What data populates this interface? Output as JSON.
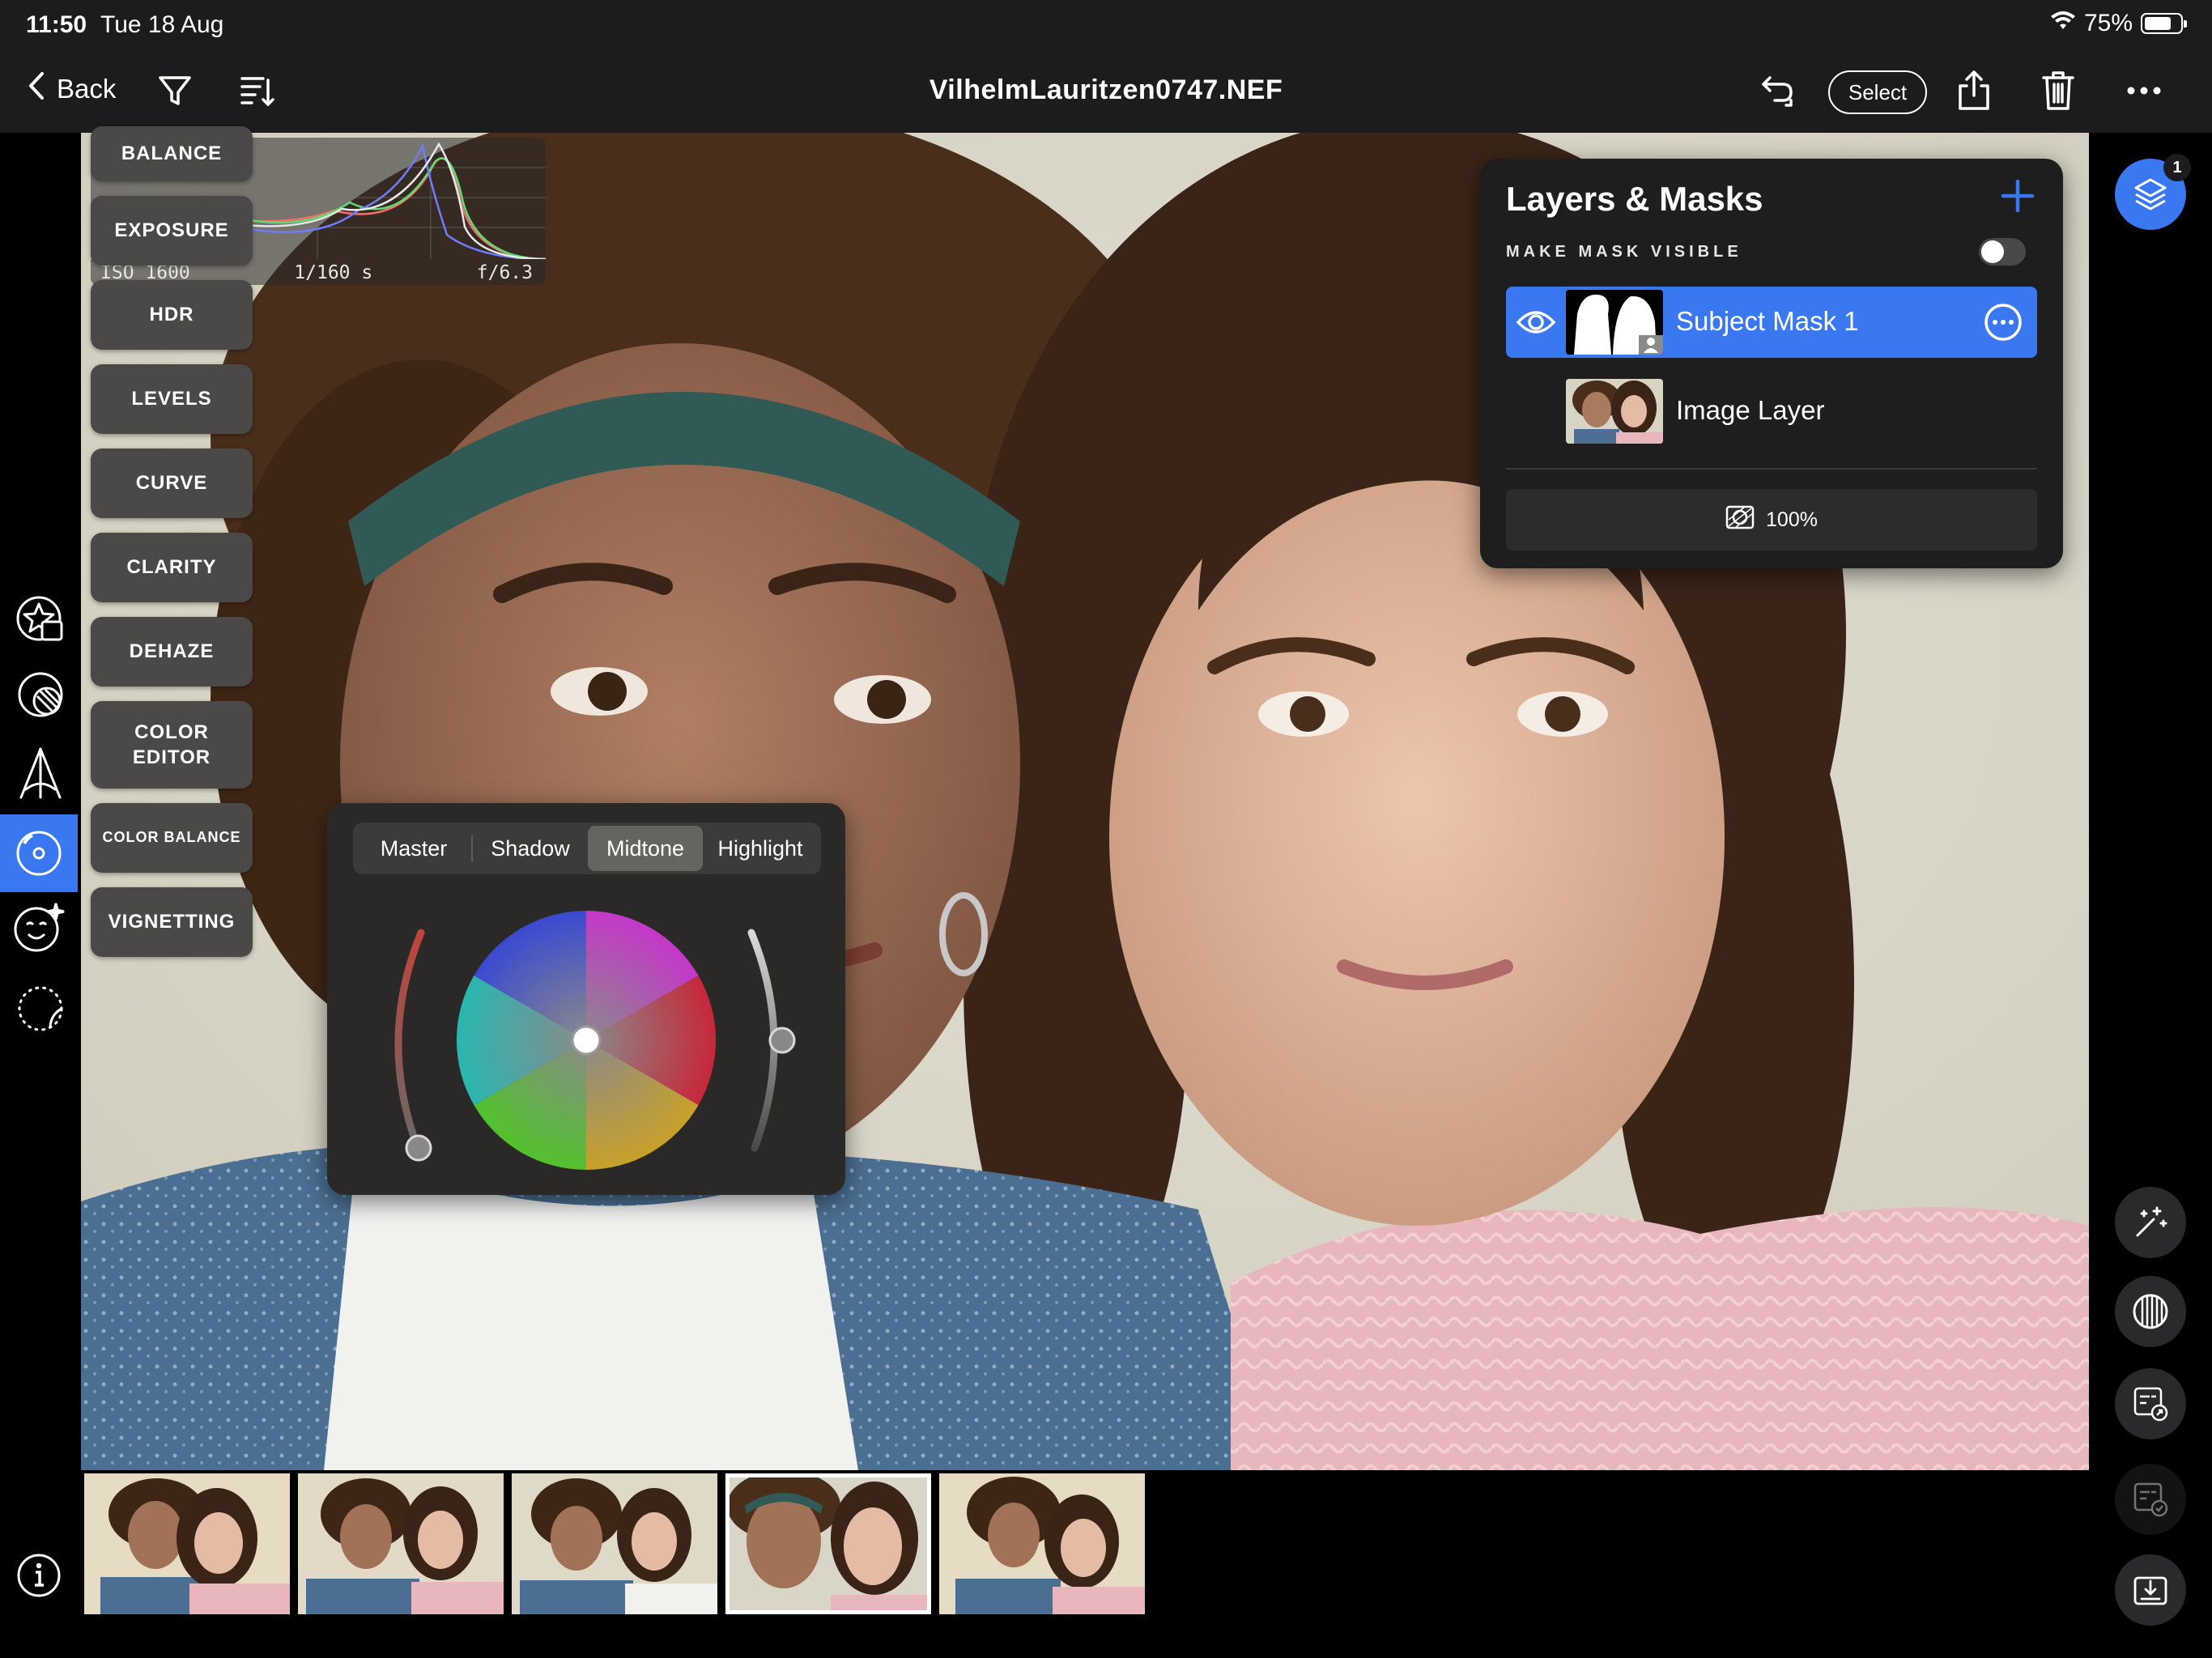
{
  "status_bar": {
    "time": "11:50",
    "date": "Tue 18 Aug",
    "battery": "75%",
    "battery_level": 0.75
  },
  "nav": {
    "back_label": "Back",
    "title": "VilhelmLauritzen0747.NEF",
    "select_label": "Select",
    "icons": [
      "chevron-left-icon",
      "filter-icon",
      "sort-icon",
      "undo-icon",
      "share-icon",
      "trash-icon",
      "more-icon"
    ]
  },
  "histogram": {
    "iso": "ISO 1600",
    "shutter": "1/160 s",
    "aperture": "f/6.3"
  },
  "adjustments": [
    {
      "label": "BALANCE"
    },
    {
      "label": "EXPOSURE"
    },
    {
      "label": "HDR"
    },
    {
      "label": "LEVELS"
    },
    {
      "label": "CURVE"
    },
    {
      "label": "CLARITY"
    },
    {
      "label": "DEHAZE"
    },
    {
      "label": "COLOR EDITOR"
    },
    {
      "label": "COLOR BALANCE"
    },
    {
      "label": "VIGNETTING"
    }
  ],
  "color_balance": {
    "tabs": [
      "Master",
      "Shadow",
      "Midtone",
      "Highlight"
    ],
    "active_tab": "Midtone"
  },
  "layers_panel": {
    "title": "Layers & Masks",
    "mask_visible_label": "MAKE MASK VISIBLE",
    "mask_visible": false,
    "layers": [
      {
        "name": "Subject Mask 1",
        "selected": true
      },
      {
        "name": "Image Layer",
        "selected": false
      }
    ],
    "opacity": "100%"
  },
  "layers_badge": "1",
  "left_rail_icons": [
    "star-stack-icon",
    "sphere-icon",
    "perspective-icon",
    "color-balance-icon",
    "face-sparkle-icon",
    "dotted-circle-icon",
    "info-icon"
  ],
  "right_rail_icons": [
    "magic-wand-icon",
    "grain-icon",
    "preset-export-icon",
    "preset-apply-icon",
    "export-icon"
  ],
  "filmstrip": {
    "count": 5,
    "current_index": 3
  },
  "colors": {
    "accent": "#3a78f2",
    "panel": "#1e1e1e",
    "button": "#4a4947"
  }
}
